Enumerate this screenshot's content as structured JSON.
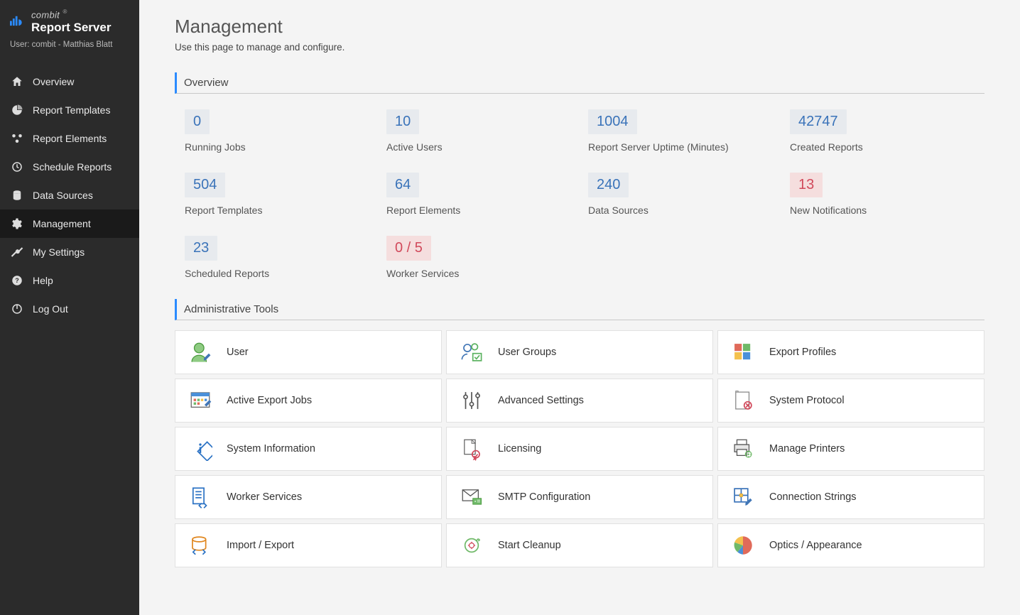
{
  "brand": {
    "top": "combit",
    "main": "Report Server",
    "reg": "®"
  },
  "user_line": "User: combit - Matthias Blatt",
  "sidebar": {
    "items": [
      {
        "label": "Overview"
      },
      {
        "label": "Report Templates"
      },
      {
        "label": "Report Elements"
      },
      {
        "label": "Schedule Reports"
      },
      {
        "label": "Data Sources"
      },
      {
        "label": "Management"
      },
      {
        "label": "My Settings"
      },
      {
        "label": "Help"
      },
      {
        "label": "Log Out"
      }
    ]
  },
  "page": {
    "title": "Management",
    "subtitle": "Use this page to manage and configure."
  },
  "overview_title": "Overview",
  "stats": [
    {
      "value": "0",
      "label": "Running Jobs"
    },
    {
      "value": "10",
      "label": "Active Users"
    },
    {
      "value": "1004",
      "label": "Report Server Uptime (Minutes)"
    },
    {
      "value": "42747",
      "label": "Created Reports"
    },
    {
      "value": "504",
      "label": "Report Templates"
    },
    {
      "value": "64",
      "label": "Report Elements"
    },
    {
      "value": "240",
      "label": "Data Sources"
    },
    {
      "value": "13",
      "label": "New Notifications",
      "red": true
    },
    {
      "value": "23",
      "label": "Scheduled Reports"
    },
    {
      "value": "0 / 5",
      "label": "Worker Services",
      "red": true
    }
  ],
  "tools_title": "Administrative Tools",
  "tools": [
    {
      "label": "User"
    },
    {
      "label": "User Groups"
    },
    {
      "label": "Export Profiles"
    },
    {
      "label": "Active Export Jobs"
    },
    {
      "label": "Advanced Settings"
    },
    {
      "label": "System Protocol"
    },
    {
      "label": "System Information"
    },
    {
      "label": "Licensing"
    },
    {
      "label": "Manage Printers"
    },
    {
      "label": "Worker Services"
    },
    {
      "label": "SMTP Configuration"
    },
    {
      "label": "Connection Strings"
    },
    {
      "label": "Import / Export"
    },
    {
      "label": "Start Cleanup"
    },
    {
      "label": "Optics / Appearance"
    }
  ]
}
